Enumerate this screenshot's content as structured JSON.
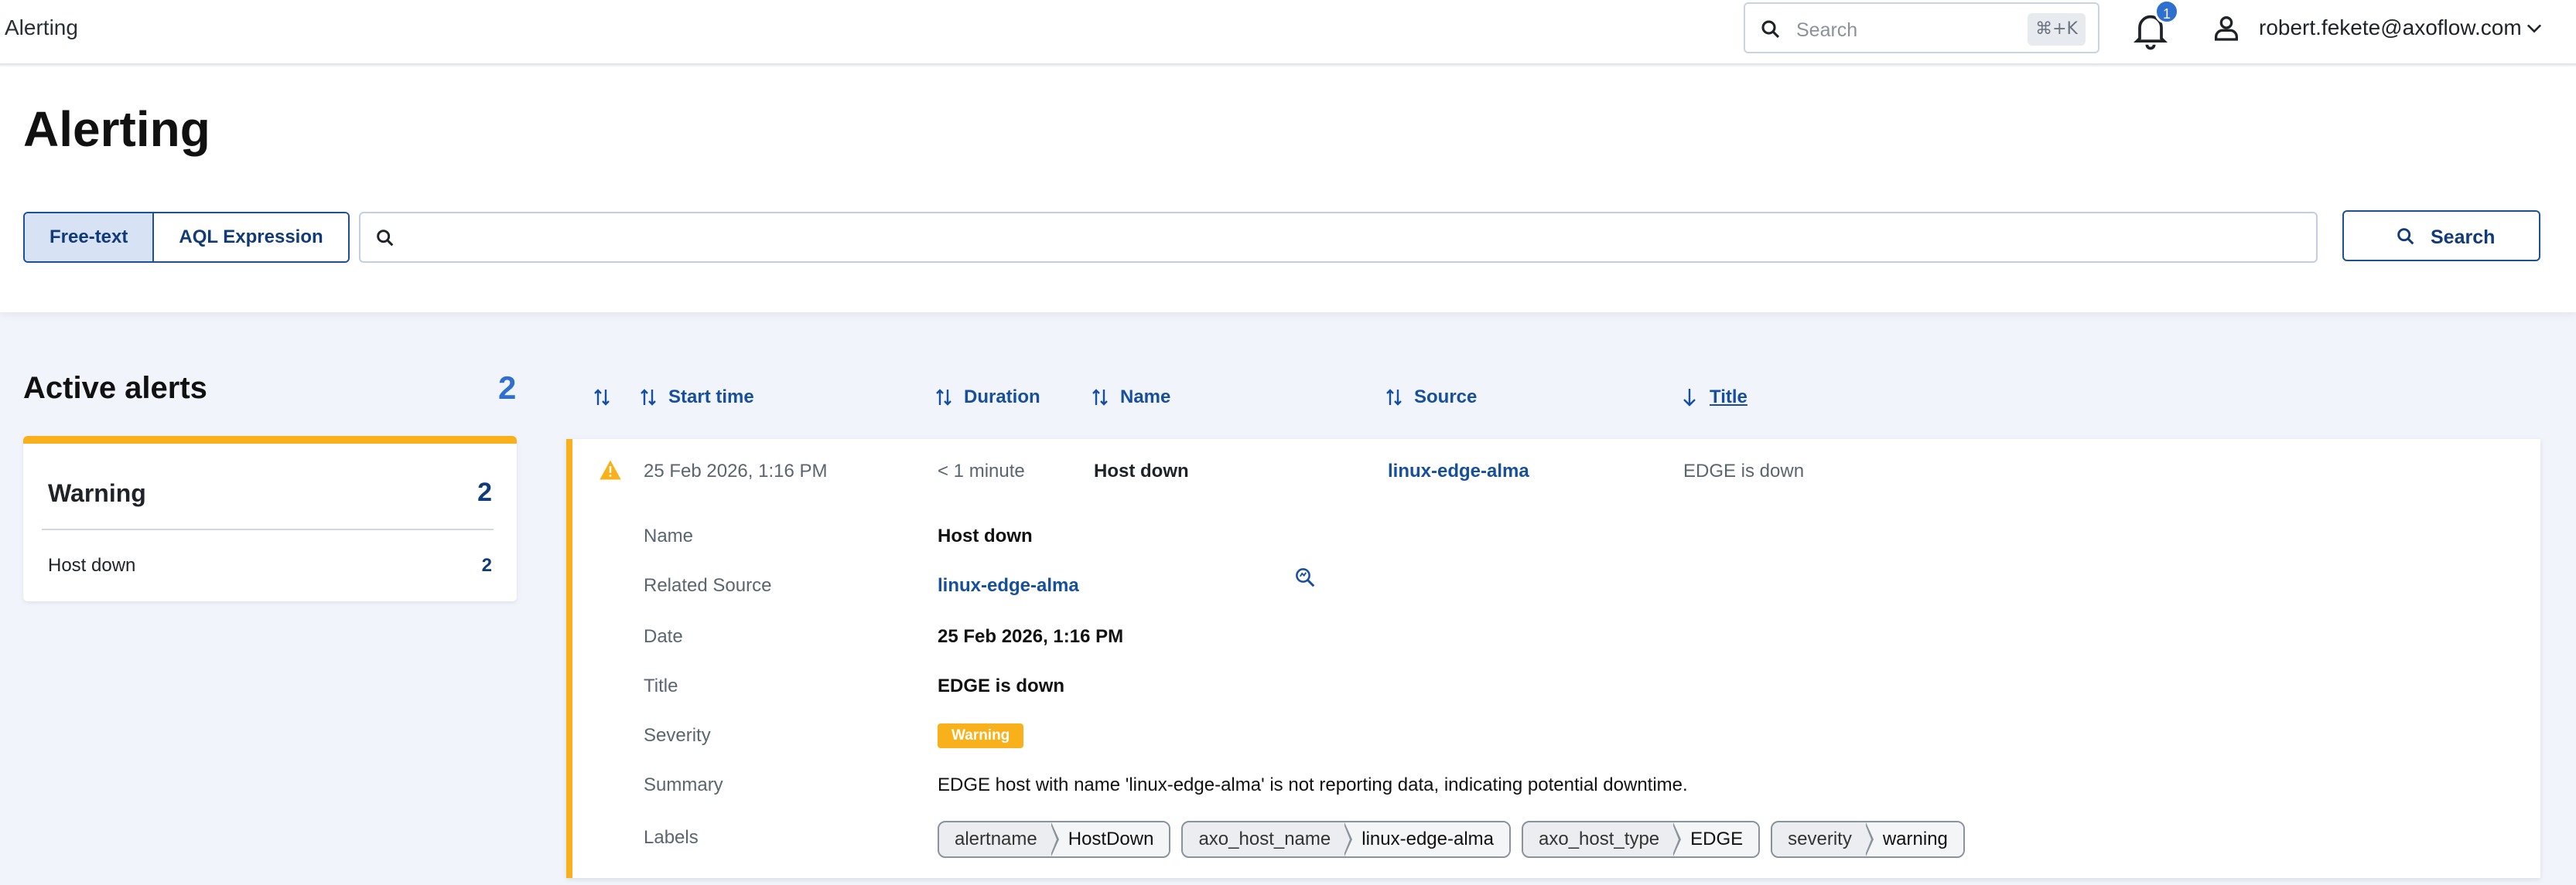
{
  "app": {
    "title": "Alerting"
  },
  "topbar": {
    "search_placeholder": "Search",
    "shortcut": "⌘+K",
    "notifications_count": "1",
    "user_name": "robert.fekete@axoflow.com"
  },
  "page": {
    "title": "Alerting"
  },
  "filter": {
    "modes": [
      "Free-text",
      "AQL Expression"
    ],
    "active_mode": "Free-text",
    "query_value": "",
    "search_button": "Search"
  },
  "sidebar": {
    "title": "Active alerts",
    "count": "2",
    "groups": [
      {
        "severity": "Warning",
        "count": "2",
        "items": [
          {
            "label": "Host down",
            "count": "2"
          }
        ]
      }
    ]
  },
  "table": {
    "columns": [
      "Start time",
      "Duration",
      "Name",
      "Source",
      "Title"
    ],
    "sort": {
      "column": "Title",
      "direction": "descending"
    },
    "rows": [
      {
        "start_time": "25 Feb 2026, 1:16 PM",
        "duration": "< 1 minute",
        "name": "Host down",
        "source": "linux-edge-alma",
        "title": "EDGE is down"
      }
    ]
  },
  "details": {
    "labels": {
      "name": "Name",
      "related_source": "Related Source",
      "date": "Date",
      "title": "Title",
      "severity": "Severity",
      "summary": "Summary",
      "labels": "Labels"
    },
    "name": "Host down",
    "related_source": "linux-edge-alma",
    "date": "25 Feb 2026, 1:16 PM",
    "title": "EDGE is down",
    "severity": "Warning",
    "summary": "EDGE host with name 'linux-edge-alma' is not reporting data, indicating potential downtime.",
    "label_chips": [
      {
        "key": "alertname",
        "value": "HostDown"
      },
      {
        "key": "axo_host_name",
        "value": "linux-edge-alma"
      },
      {
        "key": "axo_host_type",
        "value": "EDGE"
      },
      {
        "key": "severity",
        "value": "warning"
      }
    ]
  },
  "colors": {
    "accent": "#164f9e",
    "warning": "#f8b11a",
    "badge": "#2f6fcf"
  }
}
